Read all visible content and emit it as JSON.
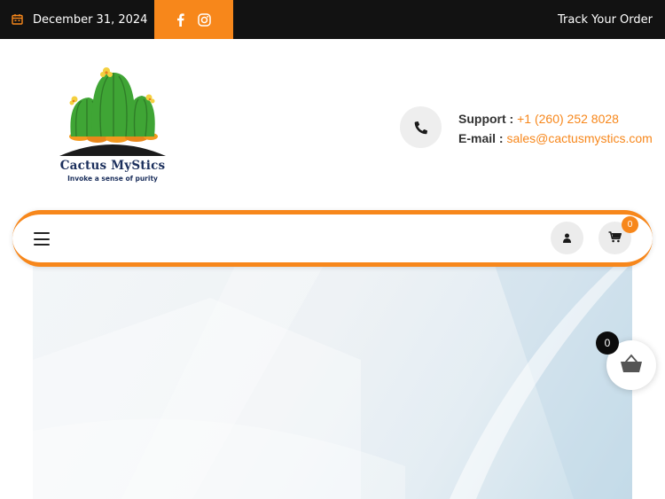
{
  "topbar": {
    "date": "December 31, 2024",
    "track_order": "Track Your Order",
    "social": [
      "facebook-icon",
      "instagram-icon"
    ],
    "accent_color": "#f7871b",
    "background_color": "#121212"
  },
  "logo": {
    "name": "Cactus MyStics",
    "tagline": "Invoke a sense of purity"
  },
  "contact": {
    "support_label": "Support :",
    "support_value": "+1 (260) 252 8028",
    "email_label": "E-mail :",
    "email_value": "sales@cactusmystics.com",
    "icon": "phone-icon"
  },
  "nav": {
    "menu_icon": "hamburger-menu-icon",
    "account_icon": "user-icon",
    "cart_icon": "cart-icon",
    "cart_count": "0"
  },
  "floating_cart": {
    "icon": "basket-icon",
    "count": "0"
  }
}
